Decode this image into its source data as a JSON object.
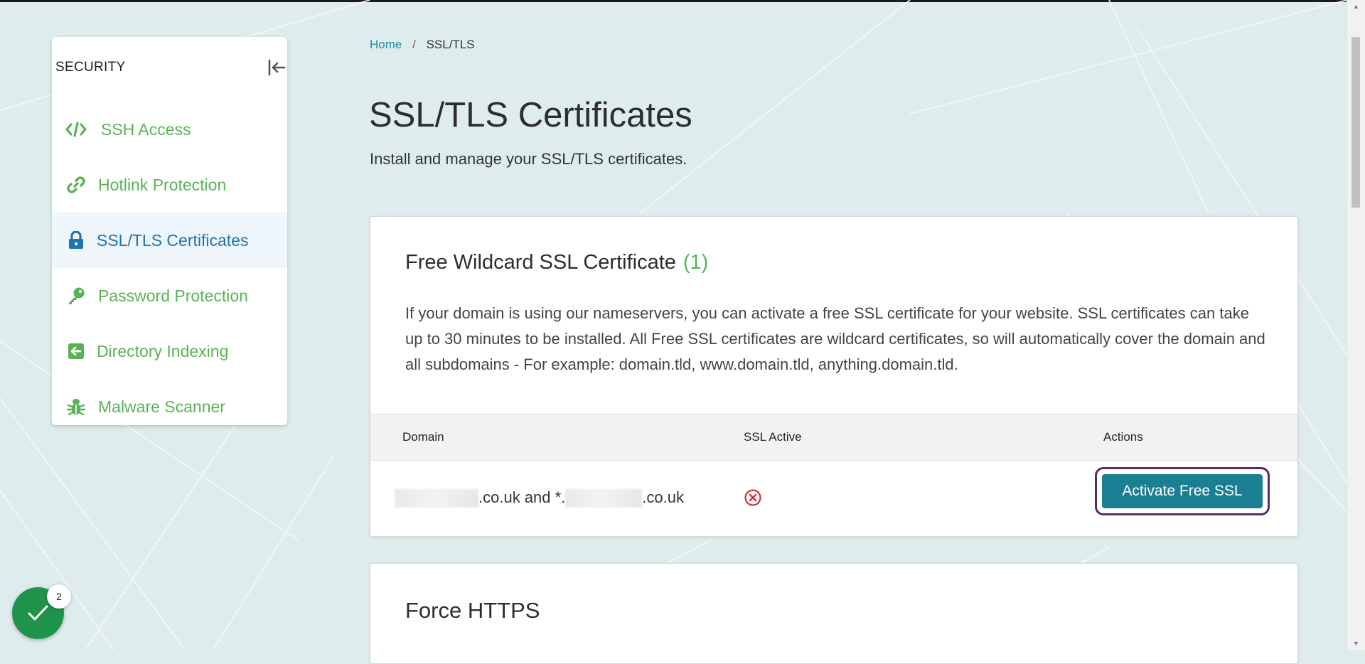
{
  "sidebar": {
    "title": "SECURITY",
    "items": [
      {
        "label": "SSH Access",
        "icon": "code-icon",
        "active": false
      },
      {
        "label": "Hotlink Protection",
        "icon": "link-icon",
        "active": false
      },
      {
        "label": "SSL/TLS Certificates",
        "icon": "lock-icon",
        "active": true
      },
      {
        "label": "Password Protection",
        "icon": "key-icon",
        "active": false
      },
      {
        "label": "Directory Indexing",
        "icon": "arrow-left-square-icon",
        "active": false
      },
      {
        "label": "Malware Scanner",
        "icon": "bug-icon",
        "active": false
      }
    ]
  },
  "breadcrumb": {
    "home": "Home",
    "separator": "/",
    "current": "SSL/TLS"
  },
  "page": {
    "title": "SSL/TLS Certificates",
    "subtitle": "Install and manage your SSL/TLS certificates."
  },
  "free_ssl": {
    "title": "Free Wildcard SSL Certificate",
    "count": "(1)",
    "description": "If your domain is using our nameservers, you can activate a free SSL certificate for your website. SSL certificates can take up to 30 minutes to be installed. All Free SSL certificates are wildcard certificates, so will automatically cover the domain and all subdomains - For example: domain.tld, www.domain.tld, anything.domain.tld.",
    "table": {
      "headers": {
        "domain": "Domain",
        "ssl_active": "SSL Active",
        "actions": "Actions"
      },
      "rows": [
        {
          "domain_part1": ".co.uk and *.",
          "domain_part2": ".co.uk",
          "ssl_active": false,
          "action": "Activate Free SSL"
        }
      ]
    }
  },
  "force_https": {
    "title": "Force HTTPS"
  },
  "widget": {
    "badge": "2"
  },
  "colors": {
    "accent_green": "#59b356",
    "active_blue": "#1f73b1",
    "button_teal": "#1b7f94",
    "focus_purple": "#5c2a6b",
    "error_red": "#d32f3f"
  }
}
